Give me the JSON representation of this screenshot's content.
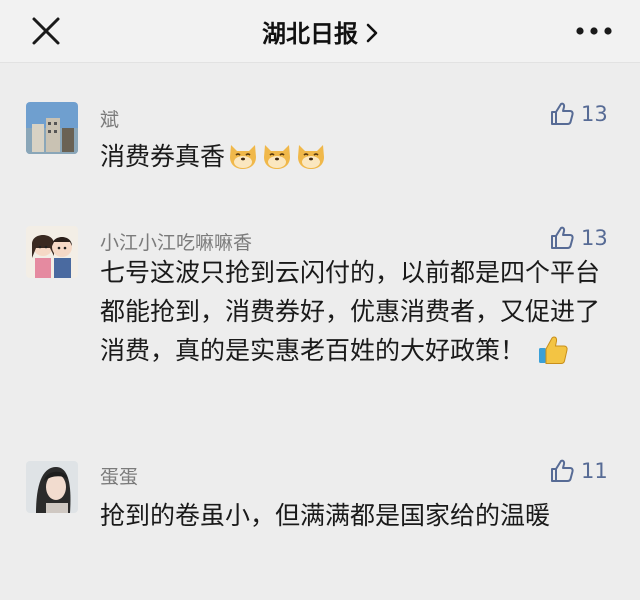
{
  "header": {
    "title": "湖北日报",
    "close_icon": "close-icon",
    "chevron_icon": "chevron-right-icon",
    "more_icon": "more-icon"
  },
  "comments": [
    {
      "author": "斌",
      "likes": "13",
      "text": "消费券真香",
      "emojis": [
        "doge-emoji",
        "doge-emoji",
        "doge-emoji"
      ]
    },
    {
      "author": "小江小江吃嘛嘛香",
      "likes": "13",
      "text": "七号这波只抢到云闪付的，以前都是四个平台都能抢到，消费券好，优惠消费者，又促进了消费，真的是实惠老百姓的大好政策！",
      "emojis": [
        "thumbs-up-emoji"
      ]
    },
    {
      "author": "蛋蛋",
      "likes": "11",
      "text": "抢到的卷虽小，但满满都是国家给的温暖",
      "emojis": []
    }
  ],
  "colors": {
    "like_blue": "#576b95",
    "nickname_gray": "#7b7b7b",
    "background": "#ededed"
  }
}
